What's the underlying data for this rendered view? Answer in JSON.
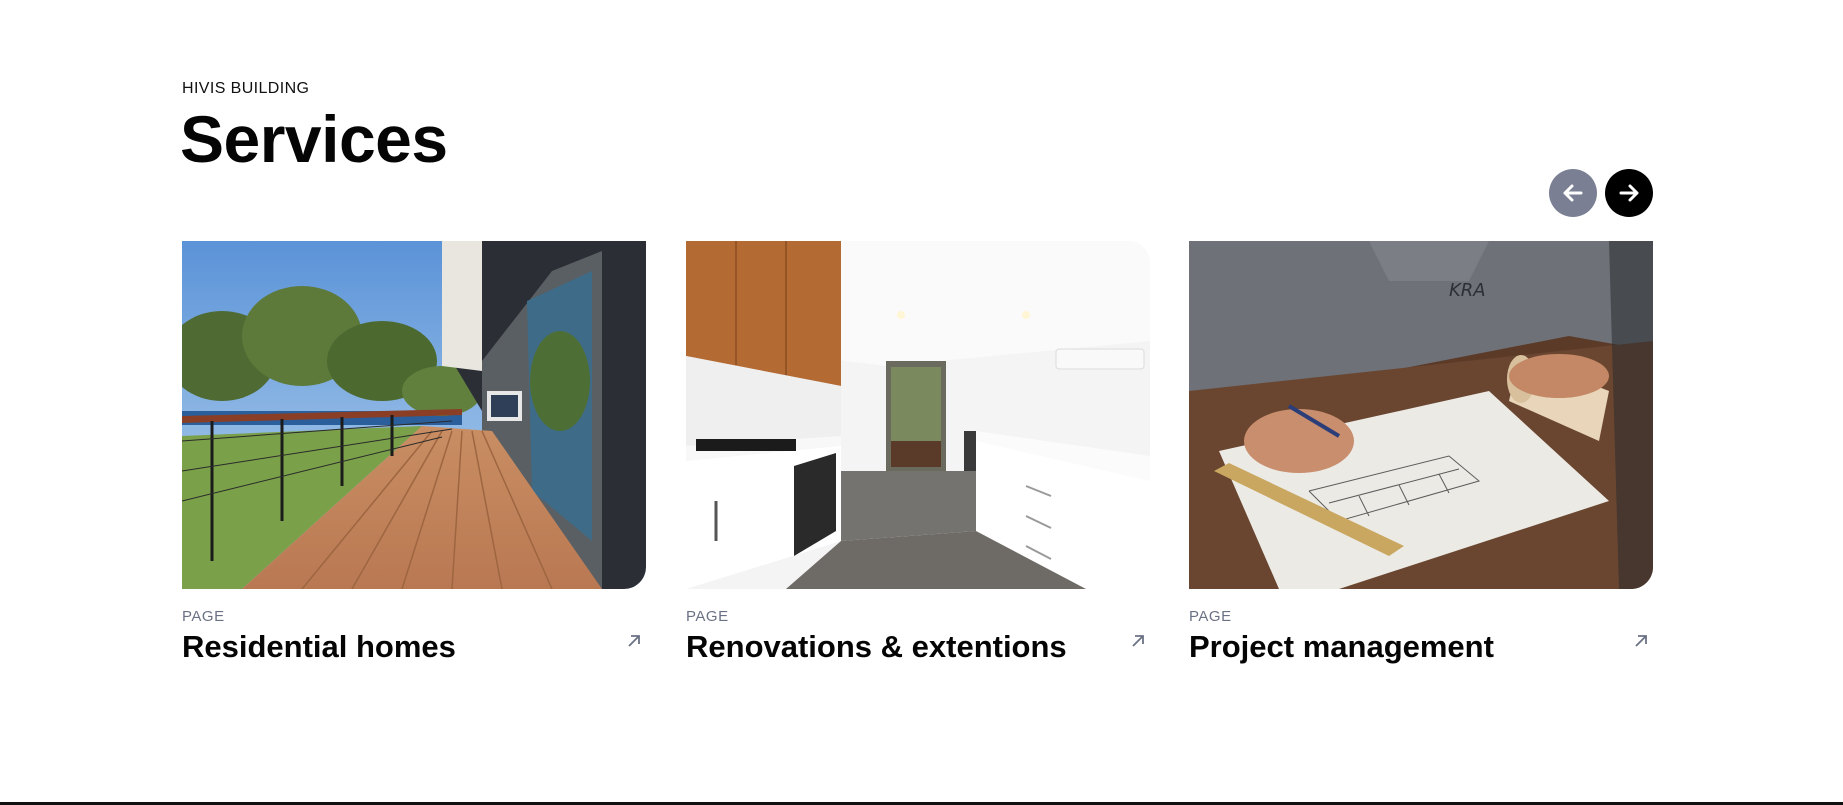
{
  "section": {
    "eyebrow": "HIVIS BUILDING",
    "title": "Services"
  },
  "carousel": {
    "prev_icon": "arrow-left-icon",
    "next_icon": "arrow-right-icon",
    "prev_color": "#7a7f93",
    "next_color": "#000000"
  },
  "cards": [
    {
      "kicker": "PAGE",
      "title": "Residential homes",
      "image": "deck-house-photo",
      "icon": "arrow-up-right-icon"
    },
    {
      "kicker": "PAGE",
      "title": "Renovations & extentions",
      "image": "kitchen-photo",
      "icon": "arrow-up-right-icon"
    },
    {
      "kicker": "PAGE",
      "title": "Project management",
      "image": "blueprint-drawing-photo",
      "icon": "arrow-up-right-icon"
    }
  ]
}
